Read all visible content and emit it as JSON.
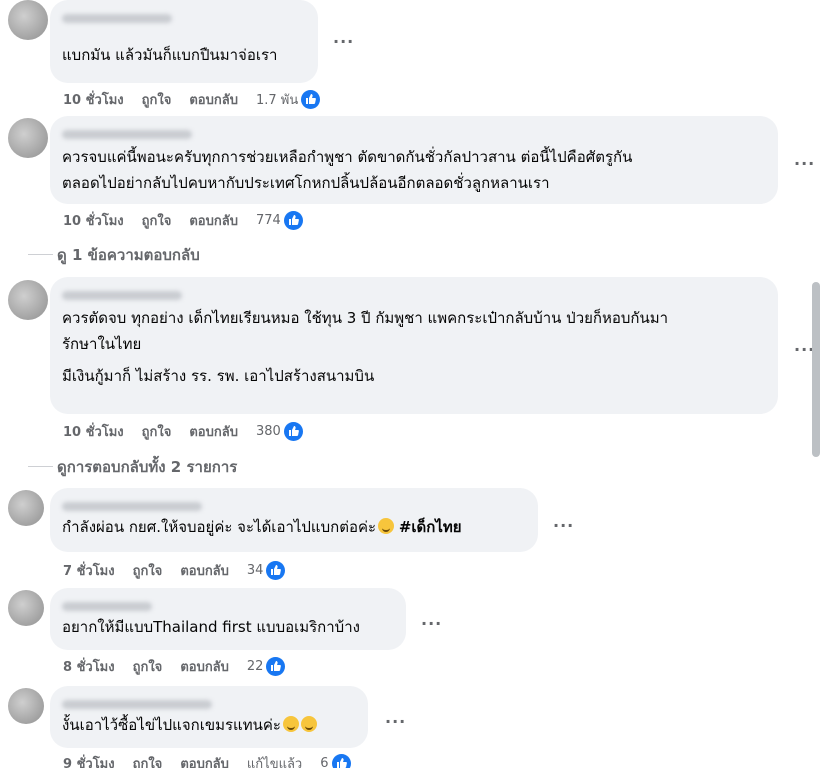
{
  "comments": [
    {
      "id": "c1",
      "text": "แบกมัน แล้วมันก็แบกปืนมาจ่อเรา",
      "time": "10 ชั่วโมง",
      "like": "ถูกใจ",
      "reply": "ตอบกลับ",
      "count": "1.7 พัน"
    },
    {
      "id": "c2",
      "text": "ควรจบแค่นี้พอนะครับทุกการช่วยเหลือกำพูชา ตัดขาดกันชั่วกัลปาวสาน ต่อนี้ไปคือศัตรูกัน\nตลอดไปอย่ากลับไปคบหากับประเทศโกหกปลิ้นปล้อนอีกตลอดชั่วลูกหลานเรา",
      "time": "10 ชั่วโมง",
      "like": "ถูกใจ",
      "reply": "ตอบกลับ",
      "count": "774"
    },
    {
      "id": "c3",
      "text": "ควรตัดจบ ทุกอย่าง เด็กไทยเรียนหมอ ใช้ทุน 3 ปี กัมพูชา แพคกระเป๋ากลับบ้าน ป่วยก็หอบกันมา\nรักษาในไทย",
      "text2": "มีเงินกู้มาก็ ไม่สร้าง รร. รพ. เอาไปสร้างสนามบิน",
      "time": "10 ชั่วโมง",
      "like": "ถูกใจ",
      "reply": "ตอบกลับ",
      "count": "380"
    },
    {
      "id": "r1",
      "text": "กำลังผ่อน กยศ.ให้จบอยู่ค่ะ จะได้เอาไปแบกต่อค่ะ",
      "hashtag": "#เด็กไทย",
      "time": "7 ชั่วโมง",
      "like": "ถูกใจ",
      "reply": "ตอบกลับ",
      "count": "34"
    },
    {
      "id": "r2",
      "text": "อยากให้มีแบบThailand first แบบอเมริกาบ้าง",
      "time": "8 ชั่วโมง",
      "like": "ถูกใจ",
      "reply": "ตอบกลับ",
      "count": "22"
    },
    {
      "id": "r3",
      "text": "งั้นเอาไว้ซื้อไข่ไปแจกเขมรแทนค่ะ",
      "time": "9 ชั่วโมง",
      "like": "ถูกใจ",
      "reply": "ตอบกลับ",
      "edited": "แก้ไขแล้ว",
      "count": "6"
    }
  ],
  "view_replies_1": "ดู 1 ข้อความตอบกลับ",
  "view_replies_2": "ดูการตอบกลับทั้ง 2 รายการ",
  "more_label": "...",
  "icons": {
    "like": "like-thumb-icon",
    "more": "more-options-icon"
  },
  "colors": {
    "bubble": "#f0f2f5",
    "like_blue": "#1877f2",
    "meta": "#65676b"
  }
}
